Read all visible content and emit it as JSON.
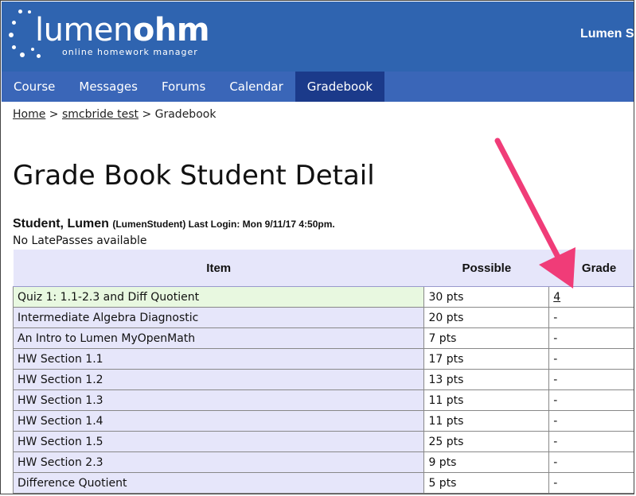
{
  "header": {
    "logo_light": "lumen",
    "logo_bold": "ohm",
    "tagline": "online homework manager",
    "user_label": "Lumen St"
  },
  "nav": {
    "items": [
      {
        "label": "Course"
      },
      {
        "label": "Messages"
      },
      {
        "label": "Forums"
      },
      {
        "label": "Calendar"
      },
      {
        "label": "Gradebook"
      }
    ],
    "active": "Gradebook"
  },
  "breadcrumb": {
    "home": "Home",
    "sep1": ">",
    "course": "smcbride test",
    "sep2": ">",
    "current": "Gradebook"
  },
  "page_title": "Grade Book Student Detail",
  "student": {
    "name": "Student, Lumen",
    "meta": "(LumenStudent) Last Login: Mon 9/11/17 4:50pm.",
    "latepasses": "No LatePasses available"
  },
  "table": {
    "headers": {
      "item": "Item",
      "possible": "Possible",
      "grade": "Grade"
    },
    "rows": [
      {
        "item": "Quiz 1: 1.1-2.3 and Diff Quotient",
        "possible": "30 pts",
        "grade": "4"
      },
      {
        "item": "Intermediate Algebra Diagnostic",
        "possible": "20 pts",
        "grade": "-"
      },
      {
        "item": "An Intro to Lumen MyOpenMath",
        "possible": "7 pts",
        "grade": "-"
      },
      {
        "item": "HW Section 1.1",
        "possible": "17 pts",
        "grade": "-"
      },
      {
        "item": "HW Section 1.2",
        "possible": "13 pts",
        "grade": "-"
      },
      {
        "item": "HW Section 1.3",
        "possible": "11 pts",
        "grade": "-"
      },
      {
        "item": "HW Section 1.4",
        "possible": "11 pts",
        "grade": "-"
      },
      {
        "item": "HW Section 1.5",
        "possible": "25 pts",
        "grade": "-"
      },
      {
        "item": "HW Section 2.3",
        "possible": "9 pts",
        "grade": "-"
      },
      {
        "item": "Difference Quotient",
        "possible": "5 pts",
        "grade": "-"
      }
    ]
  },
  "colors": {
    "header_bg": "#2f64b0",
    "nav_bg": "#3a66b8",
    "nav_active": "#1b3a8a",
    "row_bg": "#e6e6fa",
    "highlight_row": "#e8f8e0",
    "arrow": "#f03c78"
  }
}
